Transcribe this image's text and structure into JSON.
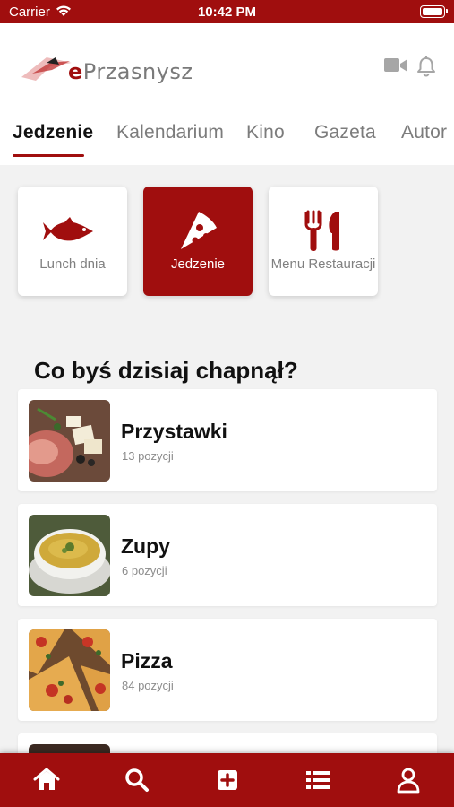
{
  "status": {
    "carrier": "Carrier",
    "time": "10:42 PM"
  },
  "header": {
    "logo_prefix": "e",
    "logo_rest": "Przasnysz",
    "icons": [
      "video-camera-icon",
      "bell-icon"
    ]
  },
  "tabs": [
    {
      "label": "Jedzenie",
      "active": true
    },
    {
      "label": "Kalendarium",
      "active": false
    },
    {
      "label": "Kino",
      "active": false
    },
    {
      "label": "Gazeta",
      "active": false
    },
    {
      "label": "Autor",
      "active": false
    }
  ],
  "categories": [
    {
      "label": "Lunch dnia",
      "icon": "fish-icon",
      "active": false
    },
    {
      "label": "Jedzenie",
      "icon": "pizza-slice-icon",
      "active": true
    },
    {
      "label": "Menu Restauracji",
      "icon": "fork-knife-icon",
      "active": false
    }
  ],
  "section_title": "Co byś dzisiaj chapnął?",
  "menu_items": [
    {
      "name": "Przystawki",
      "count": "13 pozycji",
      "thumb": "appetizer-platter-image"
    },
    {
      "name": "Zupy",
      "count": "6 pozycji",
      "thumb": "soup-bowl-image"
    },
    {
      "name": "Pizza",
      "count": "84 pozycji",
      "thumb": "pizza-image"
    }
  ],
  "bottom_nav": [
    "home-icon",
    "search-icon",
    "plus-square-icon",
    "list-icon",
    "user-icon"
  ],
  "colors": {
    "brand": "#a00e0e",
    "background": "#f2f2f2",
    "muted_text": "#808080"
  }
}
